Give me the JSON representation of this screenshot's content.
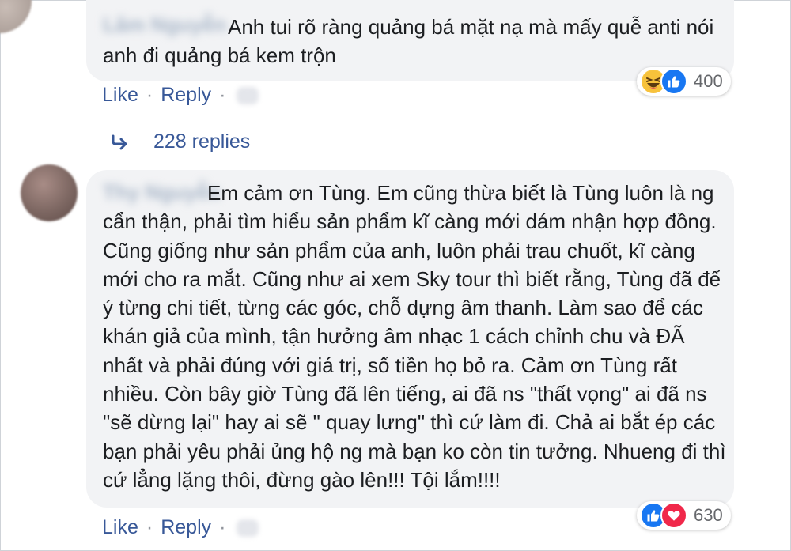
{
  "comments": [
    {
      "author": "Lâm Nguyễn",
      "text": "Anh tui rõ ràng quảng bá mặt nạ mà mấy quễ anti nói anh đi quảng bá kem trộn",
      "reactions": {
        "icons": [
          "haha-icon",
          "like-icon"
        ],
        "count": "400"
      },
      "actions": {
        "like": "Like",
        "separator": "·",
        "reply": "Reply"
      }
    },
    {
      "author": "Thy Nguyễn",
      "text": "Em cảm ơn Tùng. Em cũng thừa biết là Tùng luôn là ng cẩn thận, phải tìm hiểu sản phẩm kĩ càng mới dám nhận hợp đồng. Cũng giống như sản phẩm của anh, luôn phải trau chuốt, kĩ càng mới cho ra mắt. Cũng như ai xem Sky tour thì biết rằng, Tùng đã để ý từng chi tiết, từng các góc, chỗ dựng âm thanh. Làm sao để các khán giả của mình, tận hưởng âm nhạc 1 cách chỉnh chu và ĐÃ nhất và phải đúng với giá trị, số tiền họ bỏ ra. Cảm ơn Tùng rất nhiều. Còn bây giờ Tùng đã lên tiếng, ai đã ns \"thất vọng\" ai đã ns \"sẽ dừng lại\" hay ai sẽ \" quay lưng\" thì cứ làm đi. Chả ai bắt ép các bạn phải yêu phải ủng hộ ng mà bạn ko còn tin tưởng. Nhueng đi thì cứ lẳng lặng thôi, đừng gào lên!!! Tội lắm!!!!",
      "reactions": {
        "icons": [
          "like-icon",
          "love-icon"
        ],
        "count": "630"
      },
      "actions": {
        "like": "Like",
        "separator": "·",
        "reply": "Reply"
      }
    }
  ],
  "replies_link": {
    "icon": "reply-arrow-icon",
    "label": "228 replies"
  },
  "colors": {
    "link": "#385898",
    "bubble": "#f2f3f5",
    "like": "#1877f2",
    "love": "#f0284a",
    "haha": "#f7c23b"
  }
}
